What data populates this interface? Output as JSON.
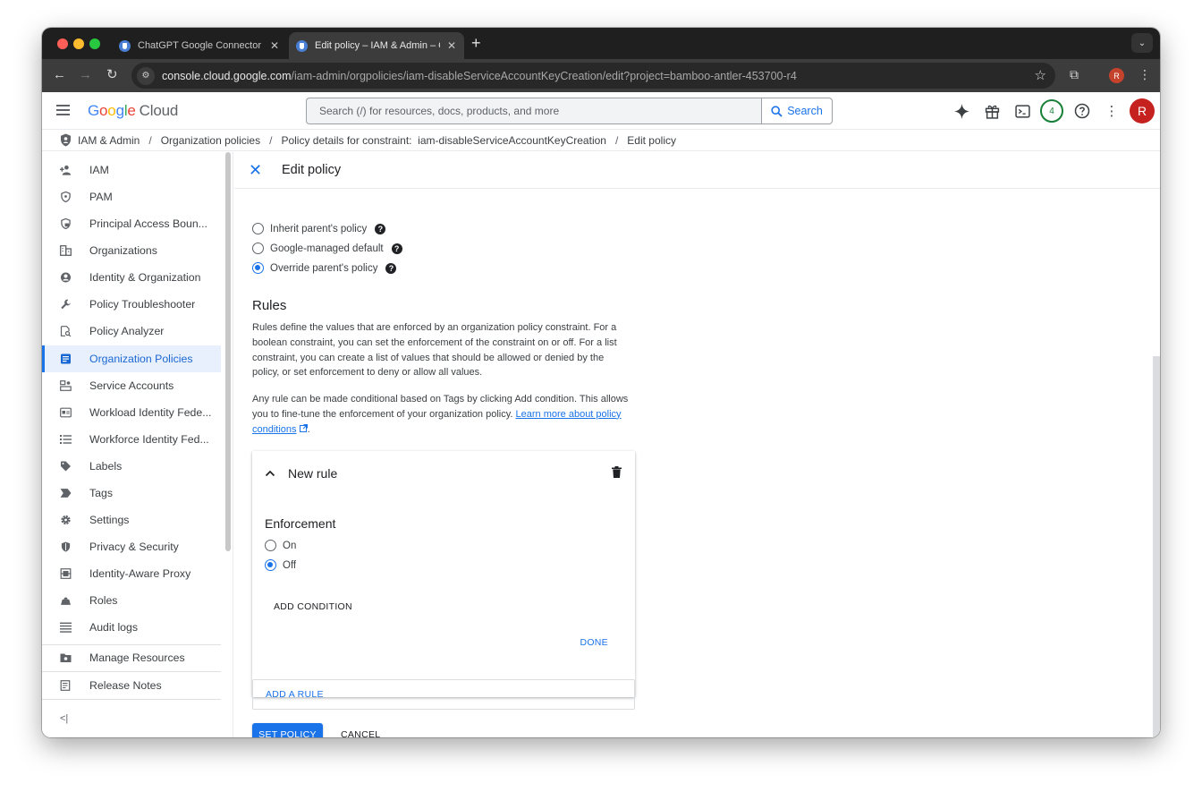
{
  "browser": {
    "tabs": [
      {
        "title": "ChatGPT Google Connector –",
        "active": false
      },
      {
        "title": "Edit policy – IAM & Admin – C",
        "active": true
      }
    ],
    "new_tab": "+",
    "url_host": "console.cloud.google.com",
    "url_path": "/iam-admin/orgpolicies/iam-disableServiceAccountKeyCreation/edit?project=bamboo-antler-453700-r4",
    "profile_initial": "R"
  },
  "header": {
    "logo_g": "G",
    "logo_o1": "o",
    "logo_o2": "o",
    "logo_g2": "g",
    "logo_l": "l",
    "logo_e": "e",
    "logo_cloud": "Cloud",
    "search_placeholder": "Search (/) for resources, docs, products, and more",
    "search_button": "Search",
    "notification_count": "4",
    "avatar_initial": "R"
  },
  "breadcrumb": {
    "items": [
      "IAM & Admin",
      "Organization policies",
      "Policy details for constraint:  iam-disableServiceAccountKeyCreation",
      "Edit policy"
    ],
    "separator": "/"
  },
  "sidebar": {
    "items": [
      {
        "label": "IAM",
        "icon": "add-person-icon"
      },
      {
        "label": "PAM",
        "icon": "shield-icon"
      },
      {
        "label": "Principal Access Boun...",
        "icon": "shield-lock-icon"
      },
      {
        "label": "Organizations",
        "icon": "building-icon"
      },
      {
        "label": "Identity & Organization",
        "icon": "account-circle-icon"
      },
      {
        "label": "Policy Troubleshooter",
        "icon": "wrench-icon"
      },
      {
        "label": "Policy Analyzer",
        "icon": "doc-search-icon"
      },
      {
        "label": "Organization Policies",
        "icon": "article-icon",
        "active": true
      },
      {
        "label": "Service Accounts",
        "icon": "service-account-icon"
      },
      {
        "label": "Workload Identity Fede...",
        "icon": "badge-icon"
      },
      {
        "label": "Workforce Identity Fed...",
        "icon": "list-icon"
      },
      {
        "label": "Labels",
        "icon": "label-icon"
      },
      {
        "label": "Tags",
        "icon": "tag-icon"
      },
      {
        "label": "Settings",
        "icon": "gear-icon"
      },
      {
        "label": "Privacy & Security",
        "icon": "privacy-shield-icon"
      },
      {
        "label": "Identity-Aware Proxy",
        "icon": "proxy-icon"
      },
      {
        "label": "Roles",
        "icon": "roles-icon"
      },
      {
        "label": "Audit logs",
        "icon": "lines-icon"
      }
    ],
    "footer": [
      {
        "label": "Manage Resources",
        "icon": "folder-gear-icon"
      },
      {
        "label": "Release Notes",
        "icon": "notes-icon"
      }
    ],
    "collapse": "<|"
  },
  "main": {
    "title": "Edit policy",
    "policy_source": [
      {
        "label": "Inherit parent's policy",
        "checked": false
      },
      {
        "label": "Google-managed default",
        "checked": false
      },
      {
        "label": "Override parent's policy",
        "checked": true
      }
    ],
    "help_glyph": "?",
    "rules_heading": "Rules",
    "rules_desc": "Rules define the values that are enforced by an organization policy constraint. For a boolean constraint, you can set the enforcement of the constraint on or off. For a list constraint, you can create a list of values that should be allowed or denied by the policy, or set enforcement to deny or allow all values.",
    "conditional_desc": "Any rule can be made conditional based on Tags by clicking Add condition. This allows you to fine-tune the enforcement of your organization policy. ",
    "learn_more": "Learn more about policy conditions",
    "rule": {
      "title": "New rule",
      "enforcement_label": "Enforcement",
      "options": [
        {
          "label": "On",
          "checked": false
        },
        {
          "label": "Off",
          "checked": true
        }
      ],
      "add_condition": "ADD CONDITION",
      "done": "DONE"
    },
    "add_rule": "ADD A RULE",
    "set_policy": "SET POLICY",
    "cancel": "CANCEL"
  },
  "colors": {
    "accent": "#1a73e8",
    "active_bg": "#e8f0fe",
    "avatar": "#c5221f"
  }
}
